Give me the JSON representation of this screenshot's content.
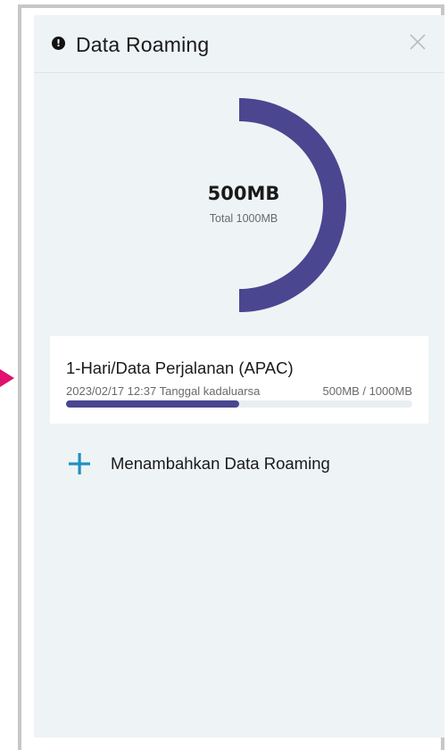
{
  "header": {
    "title": "Data Roaming",
    "alert_icon": "exclamation-circle-icon",
    "alert_glyph": "!",
    "close_icon": "close-icon"
  },
  "usage": {
    "remaining": "500MB",
    "total": "Total 1000MB",
    "remaining_fraction": 0.5
  },
  "plan": {
    "name": "1-Hari/Data Perjalanan (APAC)",
    "expiry": "2023/02/17 12:37 Tanggal kadaluarsa",
    "usage": "500MB / 1000MB",
    "progress_fraction": 0.5
  },
  "add_action": {
    "label": "Menambahkan Data Roaming",
    "icon": "plus-icon"
  },
  "colors": {
    "accent": "#4a4690",
    "plus": "#1f8fc4",
    "panel_bg": "#eef4f5",
    "marker": "#e0116f"
  }
}
